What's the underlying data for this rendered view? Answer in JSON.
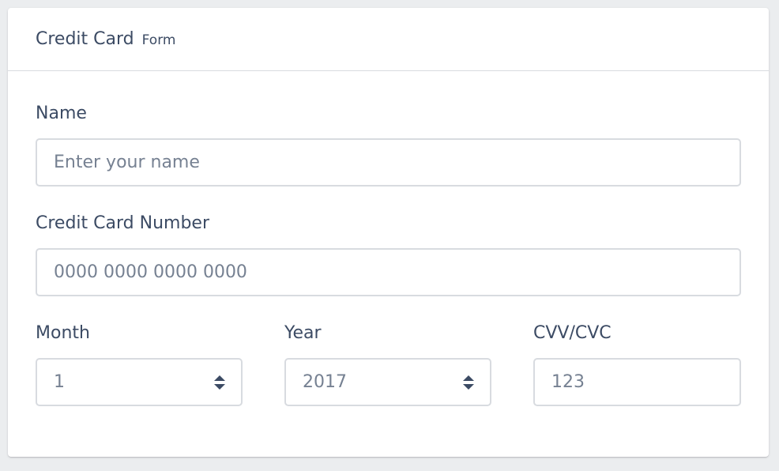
{
  "card": {
    "title": "Credit Card",
    "subtitle": "Form"
  },
  "form": {
    "name": {
      "label": "Name",
      "placeholder": "Enter your name",
      "value": ""
    },
    "card_number": {
      "label": "Credit Card Number",
      "placeholder": "0000 0000 0000 0000",
      "value": ""
    },
    "month": {
      "label": "Month",
      "selected": "1"
    },
    "year": {
      "label": "Year",
      "selected": "2017"
    },
    "cvv": {
      "label": "CVV/CVC",
      "placeholder": "123",
      "value": ""
    }
  },
  "colors": {
    "page_background": "#ebedef",
    "card_background": "#ffffff",
    "border": "#d8dbe0",
    "text": "#3c4b64",
    "placeholder": "#768192"
  },
  "icons": {
    "select_arrow": "chevron-up-down-icon"
  }
}
